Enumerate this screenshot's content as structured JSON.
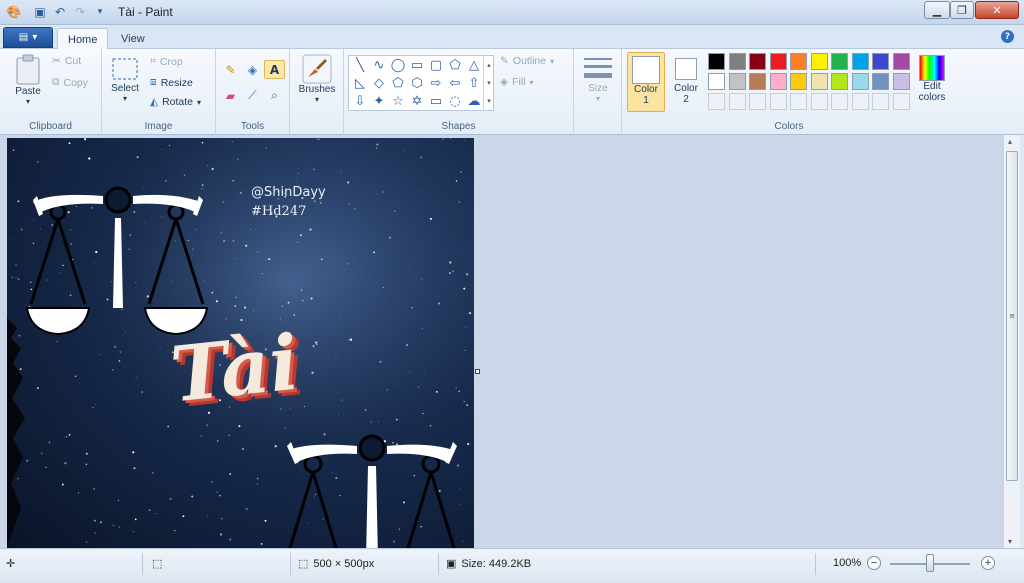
{
  "window": {
    "title": "Tài - Paint"
  },
  "tabs": [
    {
      "label": "Home"
    },
    {
      "label": "View"
    }
  ],
  "ribbon": {
    "clipboard": {
      "label": "Clipboard",
      "paste": "Paste",
      "cut": "Cut",
      "copy": "Copy"
    },
    "image": {
      "label": "Image",
      "select": "Select",
      "crop": "Crop",
      "resize": "Resize",
      "rotate": "Rotate"
    },
    "tools": {
      "label": "Tools"
    },
    "brushes": {
      "label": "Brushes"
    },
    "shapes": {
      "label": "Shapes",
      "outline": "Outline",
      "fill": "Fill"
    },
    "size": {
      "label": "Size"
    },
    "colors": {
      "label": "Colors",
      "color1": "Color",
      "color1_num": "1",
      "color2": "Color",
      "color2_num": "2",
      "edit_colors": "Edit",
      "edit_colors_2": "colors",
      "color1_value": "#ffffff",
      "color2_value": "#ffffff",
      "palette_row1": [
        "#000000",
        "#7f7f7f",
        "#880015",
        "#ed1c24",
        "#ff7f27",
        "#fff200",
        "#22b14c",
        "#00a2e8",
        "#3f48cc",
        "#a349a4"
      ],
      "palette_row2": [
        "#ffffff",
        "#c3c3c3",
        "#b97a57",
        "#ffaec9",
        "#ffc90e",
        "#efe4b0",
        "#b5e61d",
        "#99d9ea",
        "#7092be",
        "#c8bfe7"
      ]
    }
  },
  "canvas_art": {
    "handle": "@ShinDayy",
    "hashtag": "#Hd247",
    "word": "Tài"
  },
  "status": {
    "dimensions": "500 × 500px",
    "size": "Size: 449.2KB",
    "zoom": "100%"
  }
}
